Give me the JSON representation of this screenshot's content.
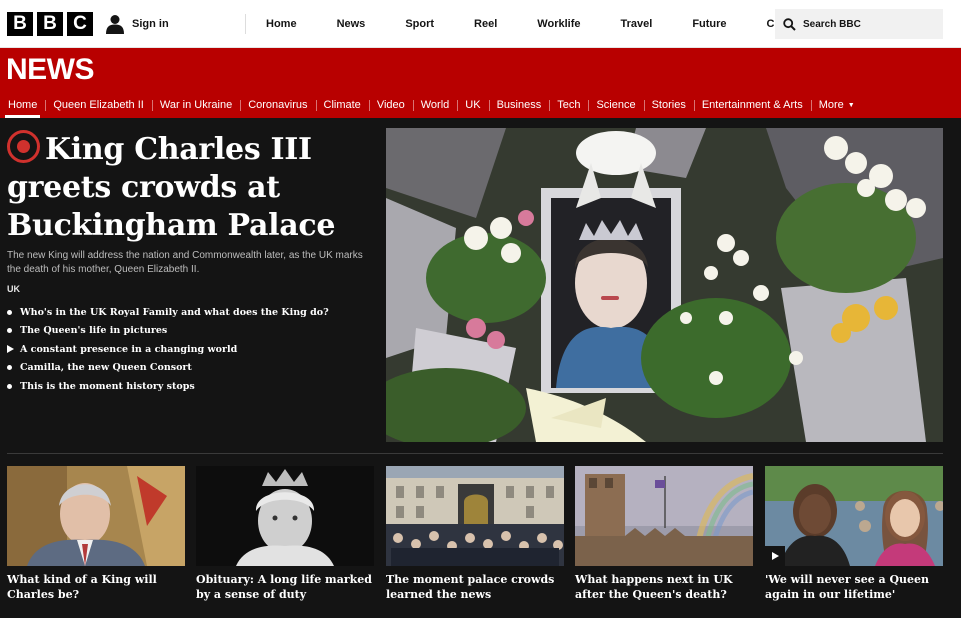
{
  "brand": {
    "letters": [
      "B",
      "B",
      "C"
    ]
  },
  "account": {
    "signin_label": "Sign in",
    "icon": "person-icon"
  },
  "global_nav": [
    "Home",
    "News",
    "Sport",
    "Reel",
    "Worklife",
    "Travel",
    "Future",
    "Culture"
  ],
  "global_nav_more_icon": "more-dots-icon",
  "search": {
    "label": "Search BBC",
    "icon": "search-icon"
  },
  "section_title": "NEWS",
  "sub_nav": {
    "items": [
      "Home",
      "Queen Elizabeth II",
      "War in Ukraine",
      "Coronavirus",
      "Climate",
      "Video",
      "World",
      "UK",
      "Business",
      "Tech",
      "Science",
      "Stories",
      "Entertainment & Arts"
    ],
    "active_index": 0,
    "more_label": "More"
  },
  "lead_story": {
    "live": true,
    "headline": "King Charles III greets crowds at Buckingham Palace",
    "summary": "The new King will address the nation and Commonwealth later, as the UK marks the death of his mother, Queen Elizabeth II.",
    "tag": "UK",
    "related": [
      {
        "text": "Who's in the UK Royal Family and what does the King do?",
        "type": "article"
      },
      {
        "text": "The Queen's life in pictures",
        "type": "article"
      },
      {
        "text": "A constant presence in a changing world",
        "type": "video"
      },
      {
        "text": "Camilla, the new Queen Consort",
        "type": "article"
      },
      {
        "text": "This is the moment history stops",
        "type": "article"
      }
    ]
  },
  "cards": [
    {
      "title": "What kind of a King will Charles be?",
      "video": false
    },
    {
      "title": "Obituary: A long life marked by a sense of duty",
      "video": false
    },
    {
      "title": "The moment palace crowds learned the news",
      "video": false
    },
    {
      "title": "What happens next in UK after the Queen's death?",
      "video": false
    },
    {
      "title": "'We will never see a Queen again in our lifetime'",
      "video": true
    }
  ],
  "colors": {
    "news_red": "#b80000",
    "page_dark": "#141414",
    "live_red": "#d0312d"
  }
}
